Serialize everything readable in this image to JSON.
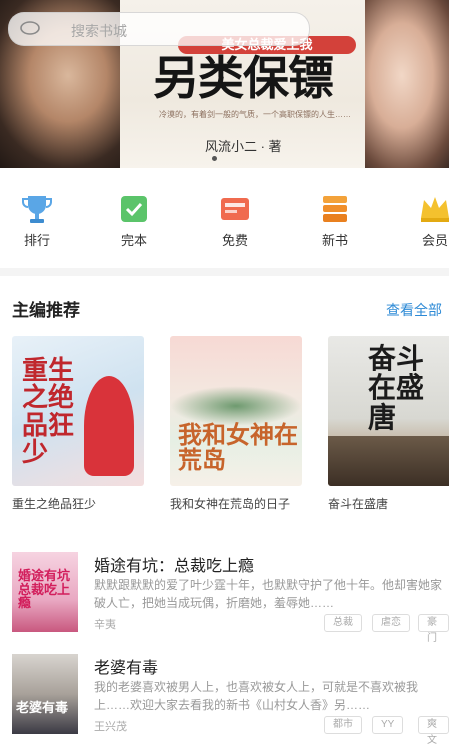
{
  "search": {
    "placeholder": "搜索书城"
  },
  "banner": {
    "subtitle": "美女总裁爱上我",
    "title": "另类保镖",
    "tagline": "冷漠的，有着剑一般的气质，一个高职保镖的人生……",
    "author": "风流小二 · 著"
  },
  "categories": [
    {
      "label": "排行",
      "icon": "trophy-icon",
      "color": "#5aa6e6"
    },
    {
      "label": "完本",
      "icon": "book-check-icon",
      "color": "#5bc46a"
    },
    {
      "label": "免费",
      "icon": "free-card-icon",
      "color": "#f06b4f"
    },
    {
      "label": "新书",
      "icon": "books-stack-icon",
      "color": "#f3a23a"
    },
    {
      "label": "会员",
      "icon": "crown-icon",
      "color": "#f4c12e"
    }
  ],
  "section": {
    "title": "主编推荐",
    "more": "查看全部"
  },
  "books": [
    {
      "title": "重生之绝品狂少",
      "cover_text": "重生之绝品狂少"
    },
    {
      "title": "我和女神在荒岛的日子",
      "cover_text": "我和女神在荒岛"
    },
    {
      "title": "奋斗在盛唐",
      "cover_text": "奋斗在盛唐"
    }
  ],
  "list": [
    {
      "title": "婚途有坑：总裁吃上瘾",
      "desc": "默默跟默默的爱了叶少霆十年，也默默守护了他十年。他却害她家破人亡，把她当成玩偶，折磨她，羞辱她……",
      "author": "辛夷",
      "tags": [
        "总裁",
        "虐恋",
        "豪门"
      ],
      "cover_text": "婚途有坑总裁吃上瘾"
    },
    {
      "title": "老婆有毒",
      "desc": "我的老婆喜欢被男人上，也喜欢被女人上，可就是不喜欢被我上……欢迎大家去看我的新书《山村女人香》另……",
      "author": "王兴茂",
      "tags": [
        "都市",
        "YY",
        "爽文"
      ],
      "cover_text": "老婆有毒"
    }
  ]
}
